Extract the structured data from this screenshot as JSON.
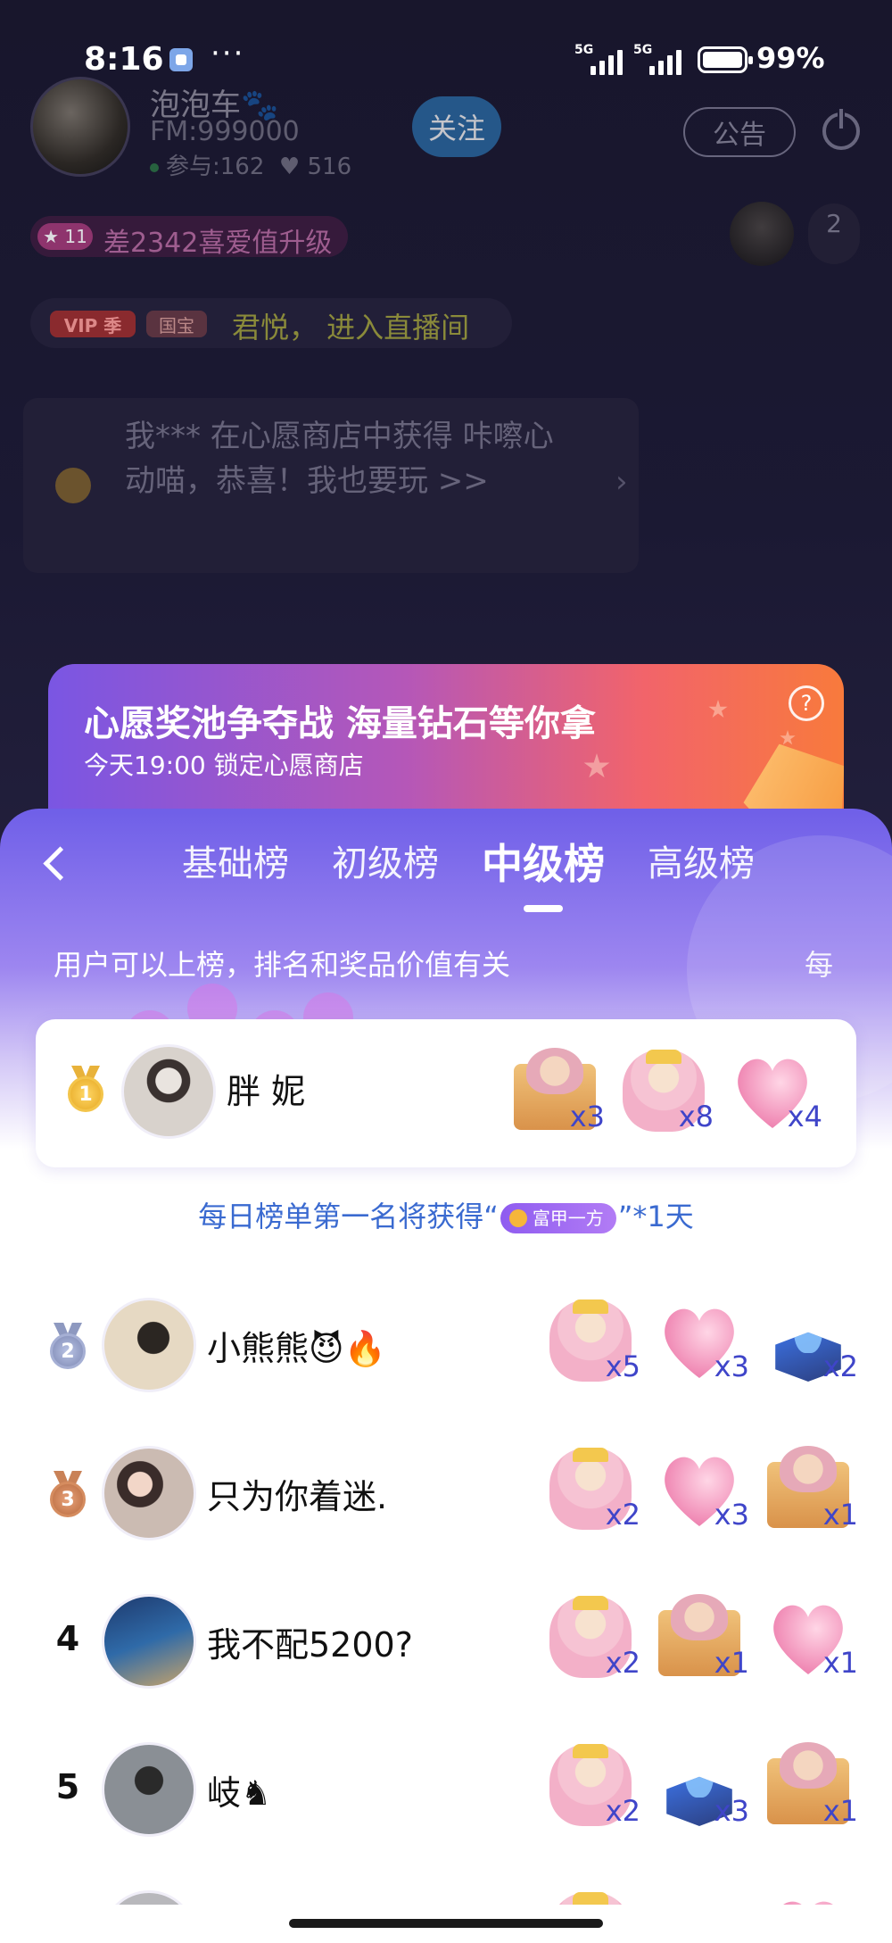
{
  "status_bar": {
    "time": "8:16",
    "dots": "···",
    "signal1_gen": "5G",
    "signal2_gen": "5G",
    "battery_text": "99%"
  },
  "host": {
    "name": "泡泡车🐾",
    "fm": "FM:999000",
    "participants": "参与:162",
    "likes": "♥ 516",
    "follow_label": "关注"
  },
  "top_right": {
    "notice_label": "公告",
    "viewer_count": "2"
  },
  "level": {
    "badge": "★ 11",
    "text": "差2342喜爱值升级"
  },
  "enter": {
    "vip_badge": "VIP 季",
    "guobao_badge": "国宝",
    "text": "君悦，  进入直播间"
  },
  "message": {
    "text": "我*** 在心愿商店中获得 咔嚓心动喵，恭喜！我也要玩 >>",
    "arrow": "›"
  },
  "banner": {
    "title": "心愿奖池争夺战 海量钻石等你拿",
    "subtitle": "今天19:00 锁定心愿商店",
    "help": "?"
  },
  "sheet": {
    "tabs": [
      {
        "label": "基础榜"
      },
      {
        "label": "初级榜"
      },
      {
        "label": "中级榜"
      },
      {
        "label": "高级榜"
      }
    ],
    "active_tab": "中级榜",
    "marquee": "用户可以上榜，排名和奖品价值有关",
    "marquee_tail": "每",
    "first": {
      "rank": "1",
      "name": "胖 妮",
      "gifts": [
        {
          "icon": "envelope-gift-icon",
          "qty": "x3"
        },
        {
          "icon": "bear-gift-icon",
          "qty": "x8"
        },
        {
          "icon": "heart-gift-icon",
          "qty": "x4"
        }
      ]
    },
    "reward_prefix": "每日榜单第一名将获得“",
    "reward_badge": "富甲一方",
    "reward_suffix": "”*1天",
    "rows": [
      {
        "rank": "2",
        "name": "小熊熊😈🔥",
        "gifts": [
          {
            "icon": "bear-gift-icon",
            "qty": "x5"
          },
          {
            "icon": "heart-gift-icon",
            "qty": "x3"
          },
          {
            "icon": "book-gift-icon",
            "qty": "x2"
          }
        ]
      },
      {
        "rank": "3",
        "name": "只为你着迷.",
        "gifts": [
          {
            "icon": "bear-gift-icon",
            "qty": "x2"
          },
          {
            "icon": "heart-gift-icon",
            "qty": "x3"
          },
          {
            "icon": "envelope-gift-icon",
            "qty": "x1"
          }
        ]
      },
      {
        "rank": "4",
        "name": "我不配5200?",
        "gifts": [
          {
            "icon": "bear-gift-icon",
            "qty": "x2"
          },
          {
            "icon": "envelope-gift-icon",
            "qty": "x1"
          },
          {
            "icon": "heart-gift-icon",
            "qty": "x1"
          }
        ]
      },
      {
        "rank": "5",
        "name": "岐♞",
        "gifts": [
          {
            "icon": "bear-gift-icon",
            "qty": "x2"
          },
          {
            "icon": "book-gift-icon",
            "qty": "x3"
          },
          {
            "icon": "envelope-gift-icon",
            "qty": "x1"
          }
        ]
      }
    ]
  }
}
